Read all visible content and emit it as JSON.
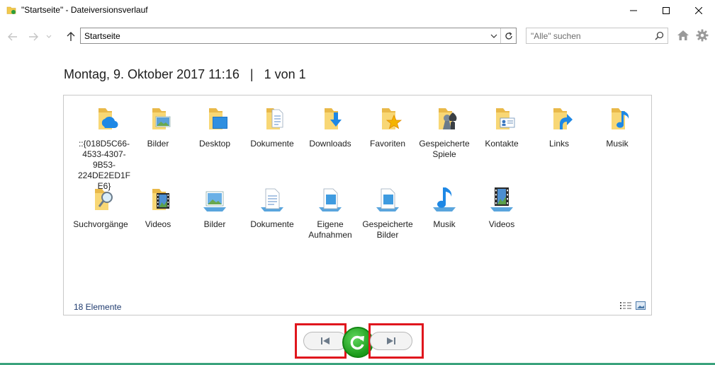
{
  "window": {
    "title": "\"Startseite\" - Dateiversionsverlauf"
  },
  "nav": {
    "address": "Startseite",
    "search_placeholder": "\"Alle\" suchen"
  },
  "heading": {
    "date": "Montag, 9. Oktober 2017 11:16",
    "separator": "|",
    "position": "1 von 1"
  },
  "items": [
    {
      "label": "::{018D5C66-4533-4307-9B53-224DE2ED1FE6}",
      "icon": "onedrive-folder-icon"
    },
    {
      "label": "Bilder",
      "icon": "pictures-folder-icon"
    },
    {
      "label": "Desktop",
      "icon": "desktop-folder-icon"
    },
    {
      "label": "Dokumente",
      "icon": "documents-folder-icon"
    },
    {
      "label": "Downloads",
      "icon": "downloads-folder-icon"
    },
    {
      "label": "Favoriten",
      "icon": "favorites-folder-icon"
    },
    {
      "label": "Gespeicherte Spiele",
      "icon": "saved-games-folder-icon"
    },
    {
      "label": "Kontakte",
      "icon": "contacts-folder-icon"
    },
    {
      "label": "Links",
      "icon": "links-folder-icon"
    },
    {
      "label": "Musik",
      "icon": "music-folder-icon"
    },
    {
      "label": "Suchvorgänge",
      "icon": "searches-folder-icon"
    },
    {
      "label": "Videos",
      "icon": "videos-folder-icon"
    },
    {
      "label": "Bilder",
      "icon": "pictures-library-icon"
    },
    {
      "label": "Dokumente",
      "icon": "documents-library-icon"
    },
    {
      "label": "Eigene Aufnahmen",
      "icon": "camera-roll-library-icon"
    },
    {
      "label": "Gespeicherte Bilder",
      "icon": "saved-pictures-library-icon"
    },
    {
      "label": "Musik",
      "icon": "music-library-icon"
    },
    {
      "label": "Videos",
      "icon": "videos-library-icon"
    }
  ],
  "status": {
    "count": "18 Elemente"
  },
  "colors": {
    "folder": "#f8d775",
    "accent_blue": "#1e88e5",
    "highlight_red": "#e0161d",
    "restore_green": "#1a9a1a"
  }
}
